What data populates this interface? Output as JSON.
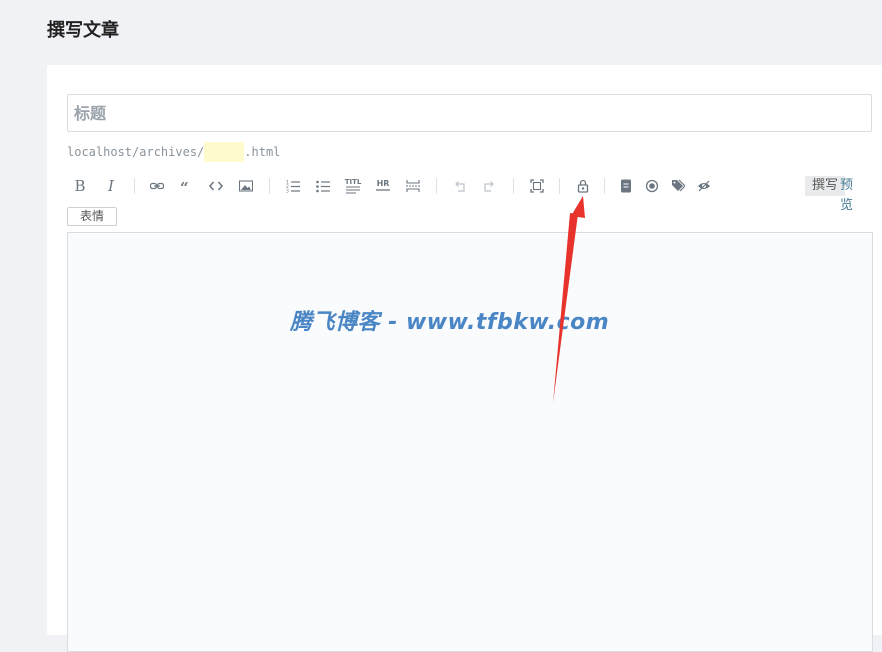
{
  "page": {
    "title": "撰写文章"
  },
  "form": {
    "title_placeholder": "标题",
    "url_prefix": "localhost/archives/",
    "url_slug": "",
    "url_suffix": ".html"
  },
  "toolbar": {
    "bold_label": "B",
    "italic_label": "I",
    "title_mini_label": "TITL",
    "hr_mini_label": "HR",
    "icons": [
      "bold",
      "italic",
      "link-icon",
      "quote-icon",
      "code-icon",
      "image-icon",
      "ordered-list-icon",
      "unordered-list-icon",
      "title-icon",
      "hr-icon",
      "more-icon",
      "undo-icon",
      "redo-icon",
      "fullscreen-icon",
      "lock-icon",
      "file-icon",
      "radio-icon",
      "tag-icon",
      "eye-icon"
    ],
    "write_tab": "撰写",
    "preview_tab": "预览"
  },
  "emoji_button": "表情",
  "editor": {
    "content": ""
  },
  "watermark": "腾飞博客 - www.tfbkw.com",
  "colors": {
    "accent": "#467b96",
    "arrow": "#e8332c",
    "watermark": "#4a86c5"
  }
}
